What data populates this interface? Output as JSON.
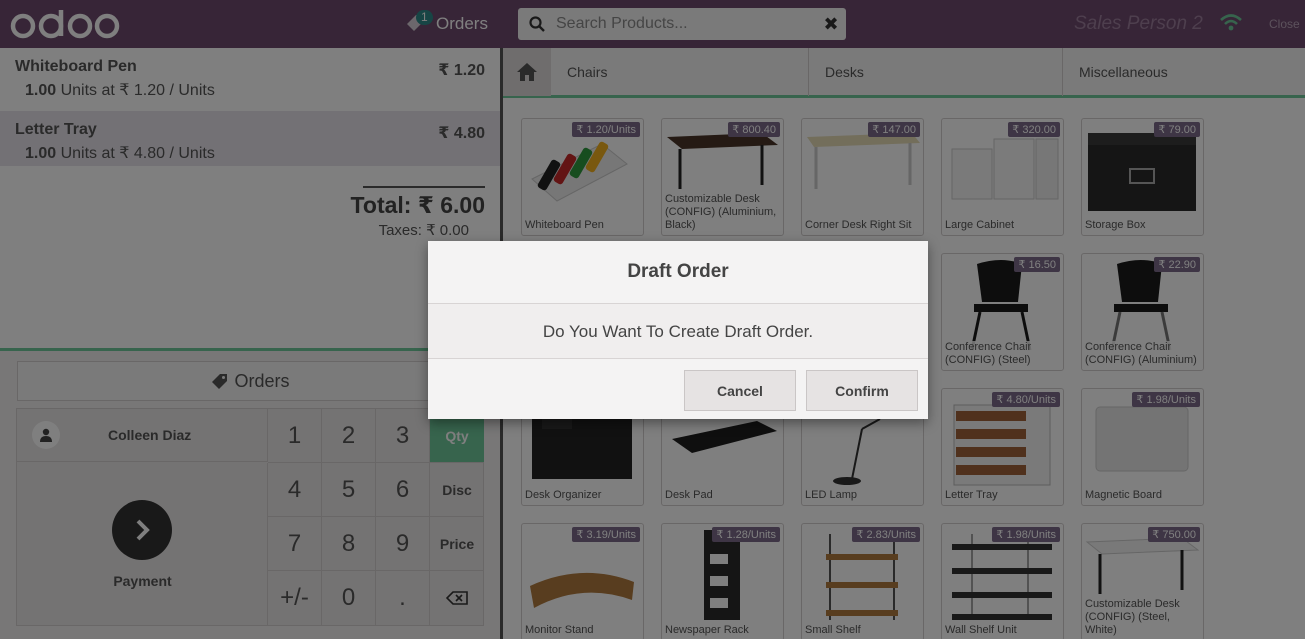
{
  "header": {
    "logo_text": "odoo",
    "orders_label": "Orders",
    "orders_count": "1",
    "search_placeholder": "Search Products...",
    "salesperson": "Sales Person 2",
    "close_label": "Close"
  },
  "order": {
    "lines": [
      {
        "name": "Whiteboard Pen",
        "price": "₹ 1.20",
        "qty": "1.00",
        "detail": " Units at ₹ 1.20 / Units",
        "selected": false
      },
      {
        "name": "Letter Tray",
        "price": "₹ 4.80",
        "qty": "1.00",
        "detail": " Units at ₹ 4.80 / Units",
        "selected": true
      }
    ],
    "total_label": "Total: ₹ 6.00",
    "taxes_label": "Taxes: ₹ 0.00"
  },
  "pad": {
    "orders_button": "Orders",
    "customer": "Colleen Diaz",
    "payment": "Payment",
    "digits": [
      "1",
      "2",
      "3",
      "4",
      "5",
      "6",
      "7",
      "8",
      "9",
      "+/-",
      "0",
      "."
    ],
    "modes": [
      "Qty",
      "Disc",
      "Price"
    ],
    "active_mode": "Qty"
  },
  "categories": [
    "Chairs",
    "Desks",
    "Miscellaneous"
  ],
  "products": [
    {
      "name": "Whiteboard Pen",
      "price": "₹ 1.20/Units"
    },
    {
      "name": "Customizable Desk (CONFIG) (Aluminium, Black)",
      "price": "₹ 800.40"
    },
    {
      "name": "Corner Desk Right Sit",
      "price": "₹ 147.00"
    },
    {
      "name": "Large Cabinet",
      "price": "₹ 320.00"
    },
    {
      "name": "Storage Box",
      "price": "₹ 79.00"
    },
    {
      "name": "Conference Chair (CONFIG) (Steel)",
      "price": "₹ 16.50"
    },
    {
      "name": "Conference Chair (CONFIG) (Aluminium)",
      "price": "₹ 22.90"
    },
    {
      "name": "Desk Organizer",
      "price": ""
    },
    {
      "name": "Desk Pad",
      "price": ""
    },
    {
      "name": "LED Lamp",
      "price": ""
    },
    {
      "name": "Letter Tray",
      "price": "₹ 4.80/Units"
    },
    {
      "name": "Magnetic Board",
      "price": "₹ 1.98/Units"
    },
    {
      "name": "Monitor Stand",
      "price": "₹ 3.19/Units"
    },
    {
      "name": "Newspaper Rack",
      "price": "₹ 1.28/Units"
    },
    {
      "name": "Small Shelf",
      "price": "₹ 2.83/Units"
    },
    {
      "name": "Wall Shelf Unit",
      "price": "₹ 1.98/Units"
    },
    {
      "name": "Customizable Desk (CONFIG) (Steel, White)",
      "price": "₹ 750.00"
    }
  ],
  "dialog": {
    "title": "Draft Order",
    "message": "Do You Want To Create Draft Order.",
    "cancel": "Cancel",
    "confirm": "Confirm"
  }
}
